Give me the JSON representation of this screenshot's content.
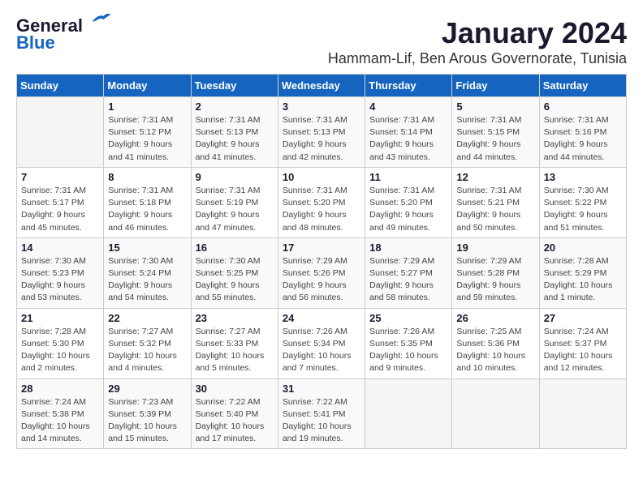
{
  "header": {
    "logo_line1": "General",
    "logo_line2": "Blue",
    "month": "January 2024",
    "location": "Hammam-Lif, Ben Arous Governorate, Tunisia"
  },
  "weekdays": [
    "Sunday",
    "Monday",
    "Tuesday",
    "Wednesday",
    "Thursday",
    "Friday",
    "Saturday"
  ],
  "weeks": [
    [
      {
        "day": "",
        "sunrise": "",
        "sunset": "",
        "daylight": ""
      },
      {
        "day": "1",
        "sunrise": "Sunrise: 7:31 AM",
        "sunset": "Sunset: 5:12 PM",
        "daylight": "Daylight: 9 hours and 41 minutes."
      },
      {
        "day": "2",
        "sunrise": "Sunrise: 7:31 AM",
        "sunset": "Sunset: 5:13 PM",
        "daylight": "Daylight: 9 hours and 41 minutes."
      },
      {
        "day": "3",
        "sunrise": "Sunrise: 7:31 AM",
        "sunset": "Sunset: 5:13 PM",
        "daylight": "Daylight: 9 hours and 42 minutes."
      },
      {
        "day": "4",
        "sunrise": "Sunrise: 7:31 AM",
        "sunset": "Sunset: 5:14 PM",
        "daylight": "Daylight: 9 hours and 43 minutes."
      },
      {
        "day": "5",
        "sunrise": "Sunrise: 7:31 AM",
        "sunset": "Sunset: 5:15 PM",
        "daylight": "Daylight: 9 hours and 44 minutes."
      },
      {
        "day": "6",
        "sunrise": "Sunrise: 7:31 AM",
        "sunset": "Sunset: 5:16 PM",
        "daylight": "Daylight: 9 hours and 44 minutes."
      }
    ],
    [
      {
        "day": "7",
        "sunrise": "Sunrise: 7:31 AM",
        "sunset": "Sunset: 5:17 PM",
        "daylight": "Daylight: 9 hours and 45 minutes."
      },
      {
        "day": "8",
        "sunrise": "Sunrise: 7:31 AM",
        "sunset": "Sunset: 5:18 PM",
        "daylight": "Daylight: 9 hours and 46 minutes."
      },
      {
        "day": "9",
        "sunrise": "Sunrise: 7:31 AM",
        "sunset": "Sunset: 5:19 PM",
        "daylight": "Daylight: 9 hours and 47 minutes."
      },
      {
        "day": "10",
        "sunrise": "Sunrise: 7:31 AM",
        "sunset": "Sunset: 5:20 PM",
        "daylight": "Daylight: 9 hours and 48 minutes."
      },
      {
        "day": "11",
        "sunrise": "Sunrise: 7:31 AM",
        "sunset": "Sunset: 5:20 PM",
        "daylight": "Daylight: 9 hours and 49 minutes."
      },
      {
        "day": "12",
        "sunrise": "Sunrise: 7:31 AM",
        "sunset": "Sunset: 5:21 PM",
        "daylight": "Daylight: 9 hours and 50 minutes."
      },
      {
        "day": "13",
        "sunrise": "Sunrise: 7:30 AM",
        "sunset": "Sunset: 5:22 PM",
        "daylight": "Daylight: 9 hours and 51 minutes."
      }
    ],
    [
      {
        "day": "14",
        "sunrise": "Sunrise: 7:30 AM",
        "sunset": "Sunset: 5:23 PM",
        "daylight": "Daylight: 9 hours and 53 minutes."
      },
      {
        "day": "15",
        "sunrise": "Sunrise: 7:30 AM",
        "sunset": "Sunset: 5:24 PM",
        "daylight": "Daylight: 9 hours and 54 minutes."
      },
      {
        "day": "16",
        "sunrise": "Sunrise: 7:30 AM",
        "sunset": "Sunset: 5:25 PM",
        "daylight": "Daylight: 9 hours and 55 minutes."
      },
      {
        "day": "17",
        "sunrise": "Sunrise: 7:29 AM",
        "sunset": "Sunset: 5:26 PM",
        "daylight": "Daylight: 9 hours and 56 minutes."
      },
      {
        "day": "18",
        "sunrise": "Sunrise: 7:29 AM",
        "sunset": "Sunset: 5:27 PM",
        "daylight": "Daylight: 9 hours and 58 minutes."
      },
      {
        "day": "19",
        "sunrise": "Sunrise: 7:29 AM",
        "sunset": "Sunset: 5:28 PM",
        "daylight": "Daylight: 9 hours and 59 minutes."
      },
      {
        "day": "20",
        "sunrise": "Sunrise: 7:28 AM",
        "sunset": "Sunset: 5:29 PM",
        "daylight": "Daylight: 10 hours and 1 minute."
      }
    ],
    [
      {
        "day": "21",
        "sunrise": "Sunrise: 7:28 AM",
        "sunset": "Sunset: 5:30 PM",
        "daylight": "Daylight: 10 hours and 2 minutes."
      },
      {
        "day": "22",
        "sunrise": "Sunrise: 7:27 AM",
        "sunset": "Sunset: 5:32 PM",
        "daylight": "Daylight: 10 hours and 4 minutes."
      },
      {
        "day": "23",
        "sunrise": "Sunrise: 7:27 AM",
        "sunset": "Sunset: 5:33 PM",
        "daylight": "Daylight: 10 hours and 5 minutes."
      },
      {
        "day": "24",
        "sunrise": "Sunrise: 7:26 AM",
        "sunset": "Sunset: 5:34 PM",
        "daylight": "Daylight: 10 hours and 7 minutes."
      },
      {
        "day": "25",
        "sunrise": "Sunrise: 7:26 AM",
        "sunset": "Sunset: 5:35 PM",
        "daylight": "Daylight: 10 hours and 9 minutes."
      },
      {
        "day": "26",
        "sunrise": "Sunrise: 7:25 AM",
        "sunset": "Sunset: 5:36 PM",
        "daylight": "Daylight: 10 hours and 10 minutes."
      },
      {
        "day": "27",
        "sunrise": "Sunrise: 7:24 AM",
        "sunset": "Sunset: 5:37 PM",
        "daylight": "Daylight: 10 hours and 12 minutes."
      }
    ],
    [
      {
        "day": "28",
        "sunrise": "Sunrise: 7:24 AM",
        "sunset": "Sunset: 5:38 PM",
        "daylight": "Daylight: 10 hours and 14 minutes."
      },
      {
        "day": "29",
        "sunrise": "Sunrise: 7:23 AM",
        "sunset": "Sunset: 5:39 PM",
        "daylight": "Daylight: 10 hours and 15 minutes."
      },
      {
        "day": "30",
        "sunrise": "Sunrise: 7:22 AM",
        "sunset": "Sunset: 5:40 PM",
        "daylight": "Daylight: 10 hours and 17 minutes."
      },
      {
        "day": "31",
        "sunrise": "Sunrise: 7:22 AM",
        "sunset": "Sunset: 5:41 PM",
        "daylight": "Daylight: 10 hours and 19 minutes."
      },
      {
        "day": "",
        "sunrise": "",
        "sunset": "",
        "daylight": ""
      },
      {
        "day": "",
        "sunrise": "",
        "sunset": "",
        "daylight": ""
      },
      {
        "day": "",
        "sunrise": "",
        "sunset": "",
        "daylight": ""
      }
    ]
  ]
}
